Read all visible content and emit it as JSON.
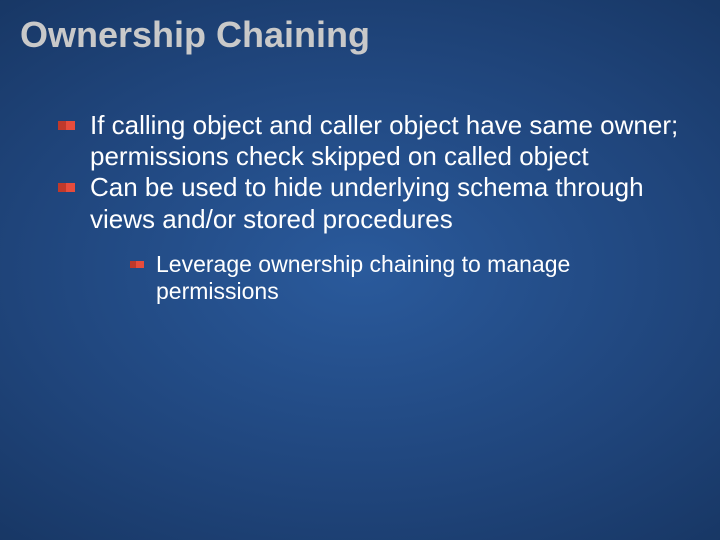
{
  "title": "Ownership Chaining",
  "bullets": [
    {
      "text": "If calling object and caller object have same owner; permissions check skipped on called object"
    },
    {
      "text": "Can be used to hide underlying schema through views and/or stored procedures",
      "sub": [
        {
          "text": "Leverage ownership chaining to manage permissions"
        }
      ]
    }
  ]
}
